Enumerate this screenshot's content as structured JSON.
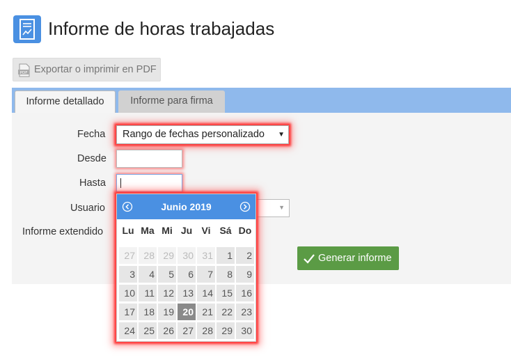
{
  "header": {
    "title": "Informe de horas trabajadas",
    "icon": "report-chart-icon"
  },
  "toolbar": {
    "export_label": "Exportar o imprimir en PDF",
    "export_icon": "pdf-icon"
  },
  "tabs": [
    {
      "label": "Informe detallado",
      "active": true
    },
    {
      "label": "Informe para firma",
      "active": false
    }
  ],
  "form": {
    "fecha_label": "Fecha",
    "fecha_value": "Rango de fechas personalizado",
    "desde_label": "Desde",
    "desde_value": "",
    "hasta_label": "Hasta",
    "hasta_value": "",
    "usuario_label": "Usuario",
    "usuario_value": "",
    "informe_extendido_label": "Informe extendido",
    "generate_label": "Generar informe"
  },
  "datepicker": {
    "title": "Junio 2019",
    "weekdays": [
      "Lu",
      "Ma",
      "Mi",
      "Ju",
      "Vi",
      "Sá",
      "Do"
    ],
    "weeks": [
      [
        {
          "d": "27",
          "other": true
        },
        {
          "d": "28",
          "other": true
        },
        {
          "d": "29",
          "other": true
        },
        {
          "d": "30",
          "other": true
        },
        {
          "d": "31",
          "other": true
        },
        {
          "d": "1"
        },
        {
          "d": "2"
        }
      ],
      [
        {
          "d": "3"
        },
        {
          "d": "4"
        },
        {
          "d": "5"
        },
        {
          "d": "6"
        },
        {
          "d": "7"
        },
        {
          "d": "8"
        },
        {
          "d": "9"
        }
      ],
      [
        {
          "d": "10"
        },
        {
          "d": "11"
        },
        {
          "d": "12"
        },
        {
          "d": "13"
        },
        {
          "d": "14"
        },
        {
          "d": "15"
        },
        {
          "d": "16"
        }
      ],
      [
        {
          "d": "17"
        },
        {
          "d": "18"
        },
        {
          "d": "19"
        },
        {
          "d": "20",
          "today": true
        },
        {
          "d": "21"
        },
        {
          "d": "22"
        },
        {
          "d": "23"
        }
      ],
      [
        {
          "d": "24"
        },
        {
          "d": "25"
        },
        {
          "d": "26"
        },
        {
          "d": "27"
        },
        {
          "d": "28"
        },
        {
          "d": "29"
        },
        {
          "d": "30"
        }
      ]
    ]
  },
  "colors": {
    "accent": "#4a90e2",
    "tabbar": "#8fb9ec",
    "success": "#5b9b45",
    "highlight": "#ff3a3a"
  }
}
